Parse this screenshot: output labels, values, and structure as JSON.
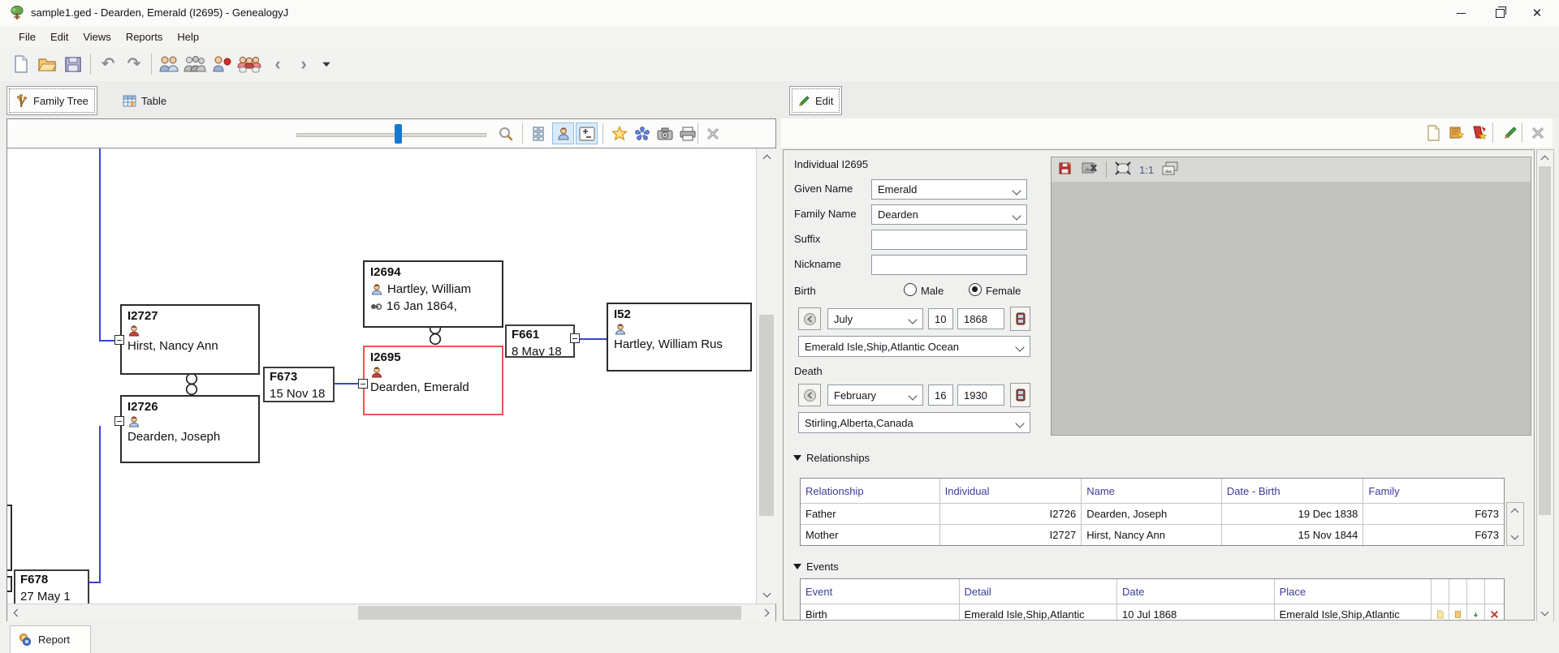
{
  "window": {
    "title": "sample1.ged - Dearden, Emerald (I2695) - GenealogyJ",
    "controls": [
      "minimize",
      "maximize",
      "close"
    ]
  },
  "menubar": {
    "items": [
      "File",
      "Edit",
      "Views",
      "Reports",
      "Help"
    ]
  },
  "main_toolbar": {
    "icons": [
      "new-file",
      "open-file",
      "save",
      "undo",
      "redo",
      "new-individual",
      "merge-individuals",
      "new-event",
      "new-family",
      "back",
      "forward",
      "more-options"
    ]
  },
  "view_tabs": {
    "family_tree": "Family Tree",
    "table": "Table",
    "edit": "Edit",
    "report": "Report"
  },
  "tree_view": {
    "toolbar_icons": [
      "zoom-slider",
      "magnifier",
      "overview",
      "show-individuals",
      "expand-collapse",
      "bookmark",
      "settings",
      "snapshot",
      "print",
      "close"
    ],
    "boxes": {
      "i2727": {
        "id": "I2727",
        "sex": "female",
        "name": "Hirst, Nancy Ann"
      },
      "i2726": {
        "id": "I2726",
        "sex": "male",
        "name": "Dearden, Joseph"
      },
      "f673": {
        "id": "F673",
        "date": "15 Nov 18"
      },
      "i2694": {
        "id": "I2694",
        "sex": "male",
        "name": "Hartley, William",
        "birth": "16 Jan 1864,"
      },
      "i2695": {
        "id": "I2695",
        "sex": "female",
        "name": "Dearden, Emerald",
        "selected": true
      },
      "f661": {
        "id": "F661",
        "date": "8 May 18"
      },
      "i52": {
        "id": "I52",
        "sex": "male",
        "name": "Hartley, William Rus"
      },
      "f678": {
        "id": "F678",
        "date": "27 May 1"
      }
    },
    "colors": {
      "link_blue": "#3a45cc",
      "selected_red": "#e8584e"
    }
  },
  "edit_panel": {
    "toolbar_icons": [
      "new-record",
      "add-bookmark",
      "delete-record",
      "edit-mode",
      "close"
    ],
    "form": {
      "title": "Individual I2695",
      "given_name_label": "Given Name",
      "given_name": "Emerald",
      "family_name_label": "Family Name",
      "family_name": "Dearden",
      "suffix_label": "Suffix",
      "suffix": "",
      "nickname_label": "Nickname",
      "nickname": "",
      "birth_label": "Birth",
      "male_label": "Male",
      "female_label": "Female",
      "sex_selected": "Female",
      "birth_month": "July",
      "birth_day": "10",
      "birth_year": "1868",
      "birth_place": "Emerald Isle,Ship,Atlantic Ocean",
      "death_label": "Death",
      "death_month": "February",
      "death_day": "16",
      "death_year": "1930",
      "death_place": "Stirling,Alberta,Canada"
    },
    "media": {
      "toolbar_icons": [
        "save-media",
        "remove-media",
        "fit-to-window",
        "one-to-one",
        "all-media"
      ],
      "zoom_label": "1:1"
    },
    "relationships": {
      "title": "Relationships",
      "columns": [
        "Relationship",
        "Individual",
        "Name",
        "Date - Birth",
        "Family"
      ],
      "rows": [
        {
          "relationship": "Father",
          "individual": "I2726",
          "name": "Dearden, Joseph",
          "date_birth": "19 Dec 1838",
          "family": "F673"
        },
        {
          "relationship": "Mother",
          "individual": "I2727",
          "name": "Hirst, Nancy Ann",
          "date_birth": "15 Nov 1844",
          "family": "F673"
        }
      ]
    },
    "events": {
      "title": "Events",
      "columns": [
        "Event",
        "Detail",
        "Date",
        "Place"
      ],
      "rows": [
        {
          "event": "Birth",
          "detail": "Emerald Isle,Ship,Atlantic",
          "date": "10 Jul 1868",
          "place": "Emerald Isle,Ship,Atlantic"
        }
      ]
    }
  }
}
